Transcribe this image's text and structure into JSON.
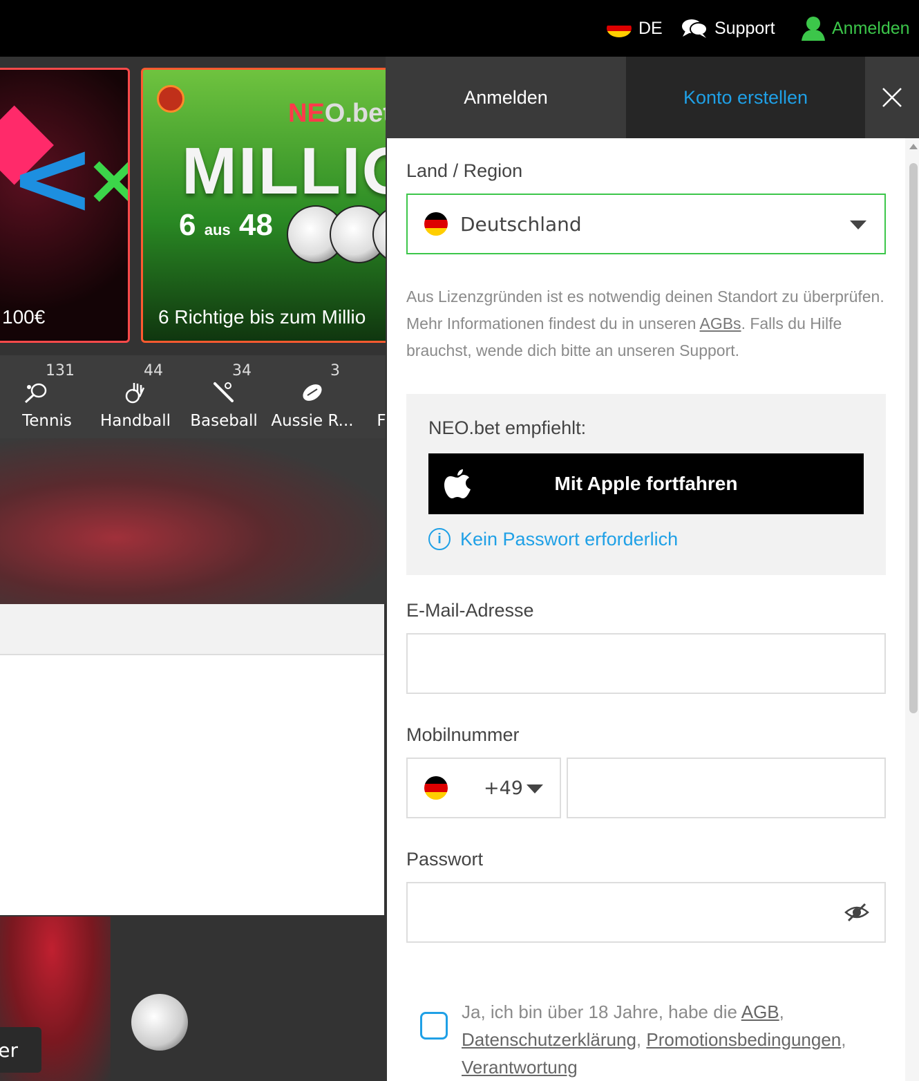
{
  "topbar": {
    "lang_code": "DE",
    "support_label": "Support",
    "login_label": "Anmelden"
  },
  "background": {
    "promos": [
      {
        "caption": "100€"
      },
      {
        "brand_a": "NE",
        "brand_b": "O.bet",
        "headline": "MILLIO",
        "lotto_a": "6",
        "lotto_mid": "aus",
        "lotto_b": "48",
        "caption": "6 Richtige bis zum Millio"
      }
    ],
    "sports": [
      {
        "count": "131",
        "label": "Tennis"
      },
      {
        "count": "44",
        "label": "Handball"
      },
      {
        "count": "34",
        "label": "Baseball"
      },
      {
        "count": "3",
        "label": "Aussie R..."
      },
      {
        "count": "",
        "label": "F"
      }
    ],
    "side_tab": "er"
  },
  "panel": {
    "tab_login": "Anmelden",
    "tab_register": "Konto erstellen",
    "country_label": "Land / Region",
    "country_value": "Deutschland",
    "info_part1": "Aus Lizenzgründen ist es notwendig deinen Standort zu überprüfen. Mehr Informationen findest du in unseren ",
    "info_link": "AGBs",
    "info_part2": ". Falls du Hilfe brauchst, wende dich bitte an unseren Support.",
    "recommend_title": "NEO.bet empfiehlt:",
    "apple_button": "Mit Apple fortfahren",
    "no_password": "Kein Passwort erforderlich",
    "email_label": "E-Mail-Adresse",
    "email_value": "",
    "phone_label": "Mobilnummer",
    "phone_prefix": "+49",
    "phone_value": "",
    "password_label": "Passwort",
    "password_value": "",
    "terms_part1": "Ja, ich bin über 18 Jahre, habe die ",
    "terms_link1": "AGB",
    "terms_sep1": ", ",
    "terms_link2": "Datenschutzerklärung",
    "terms_sep2": ", ",
    "terms_link3": "Promotionsbedingungen",
    "terms_sep3": ", ",
    "terms_link4": "Verantwortung"
  },
  "colors": {
    "accent_green": "#3cc64a",
    "accent_blue": "#1fa0e6",
    "flag_black": "#000000",
    "flag_red": "#dd0000",
    "flag_gold": "#ffce00"
  }
}
